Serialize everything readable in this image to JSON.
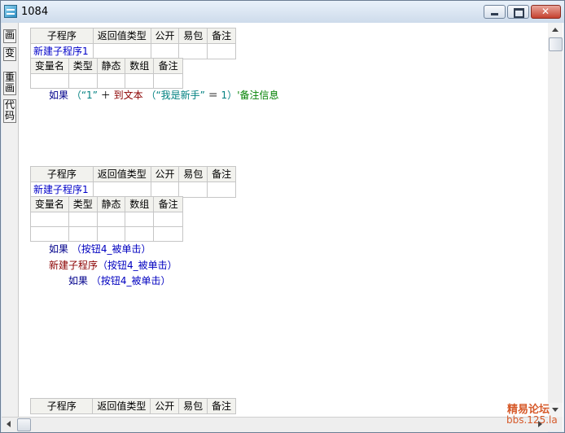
{
  "window": {
    "title": "1084"
  },
  "left_tabs": [
    "画",
    "变",
    "重画",
    "代码"
  ],
  "blocks": [
    {
      "sub_headers": [
        "子程序",
        "返回值类型",
        "公开",
        "易包",
        "备注"
      ],
      "sub_name": "新建子程序1",
      "var_headers": [
        "变量名",
        "类型",
        "静态",
        "数组",
        "备注"
      ],
      "code": {
        "kw": "如果",
        "p1": "（“1”",
        "op": "＋",
        "fn": "到文本",
        "p2": "（“我是新手”",
        "eq": "＝",
        "p3": "1）",
        "comment": "'备注信息"
      }
    },
    {
      "sub_headers": [
        "子程序",
        "返回值类型",
        "公开",
        "易包",
        "备注"
      ],
      "sub_name": "新建子程序1",
      "var_headers": [
        "变量名",
        "类型",
        "静态",
        "数组",
        "备注"
      ],
      "lines": [
        {
          "kw": "如果",
          "arg": "（按钮4_被单击）"
        },
        {
          "fn": "新建子程序",
          "arg": "（按钮4_被单击）"
        },
        {
          "kw": "如果",
          "arg": "（按钮4_被单击）"
        }
      ]
    },
    {
      "sub_headers": [
        "子程序",
        "返回值类型",
        "公开",
        "易包",
        "备注"
      ]
    }
  ],
  "watermark": {
    "line1": "精易论坛",
    "line2": "bbs.125.la"
  }
}
